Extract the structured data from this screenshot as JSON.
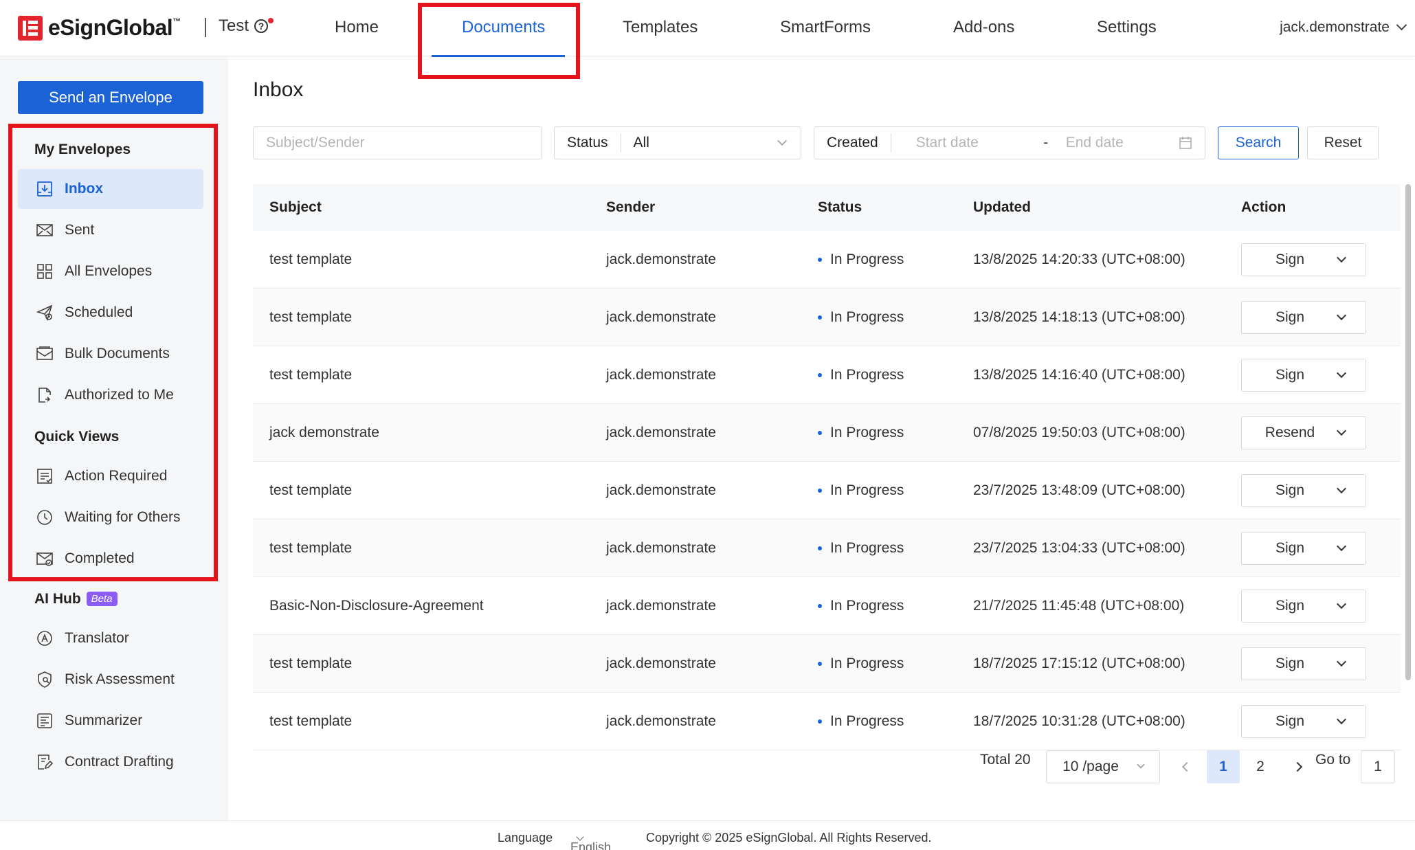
{
  "header": {
    "logo_text": "eSignGlobal",
    "logo_tm": "™",
    "org_name": "Test",
    "help_icon": "?",
    "nav": [
      "Home",
      "Documents",
      "Templates",
      "SmartForms",
      "Add-ons",
      "Settings"
    ],
    "active_nav": "Documents",
    "user": "jack.demonstrate"
  },
  "sidebar": {
    "send_button": "Send an Envelope",
    "my_envelopes_title": "My Envelopes",
    "my_envelopes": [
      {
        "label": "Inbox",
        "icon": "inbox-icon",
        "active": true
      },
      {
        "label": "Sent",
        "icon": "sent-icon"
      },
      {
        "label": "All Envelopes",
        "icon": "grid-icon"
      },
      {
        "label": "Scheduled",
        "icon": "scheduled-icon"
      },
      {
        "label": "Bulk Documents",
        "icon": "bulk-documents-icon"
      },
      {
        "label": "Authorized to Me",
        "icon": "authorized-icon"
      }
    ],
    "quick_views_title": "Quick Views",
    "quick_views": [
      {
        "label": "Action Required",
        "icon": "action-required-icon"
      },
      {
        "label": "Waiting for Others",
        "icon": "clock-icon"
      },
      {
        "label": "Completed",
        "icon": "completed-icon"
      }
    ],
    "ai_hub_title": "AI Hub",
    "ai_hub_badge": "Beta",
    "ai_hub": [
      {
        "label": "Translator",
        "icon": "translator-icon"
      },
      {
        "label": "Risk Assessment",
        "icon": "shield-icon"
      },
      {
        "label": "Summarizer",
        "icon": "summarizer-icon"
      },
      {
        "label": "Contract Drafting",
        "icon": "drafting-icon"
      }
    ]
  },
  "main": {
    "title": "Inbox",
    "filters": {
      "search_placeholder": "Subject/Sender",
      "status_label": "Status",
      "status_value": "All",
      "created_label": "Created",
      "start_placeholder": "Start date",
      "date_separator": "-",
      "end_placeholder": "End date",
      "search_button": "Search",
      "reset_button": "Reset"
    },
    "table": {
      "columns": [
        "Subject",
        "Sender",
        "Status",
        "Updated",
        "Action"
      ],
      "rows": [
        {
          "subject": "test template",
          "sender": "jack.demonstrate",
          "status": "In Progress",
          "updated": "13/8/2025 14:20:33 (UTC+08:00)",
          "action": "Sign"
        },
        {
          "subject": "test template",
          "sender": "jack.demonstrate",
          "status": "In Progress",
          "updated": "13/8/2025 14:18:13 (UTC+08:00)",
          "action": "Sign"
        },
        {
          "subject": "test template",
          "sender": "jack.demonstrate",
          "status": "In Progress",
          "updated": "13/8/2025 14:16:40 (UTC+08:00)",
          "action": "Sign"
        },
        {
          "subject": "jack demonstrate",
          "sender": "jack.demonstrate",
          "status": "In Progress",
          "updated": "07/8/2025 19:50:03 (UTC+08:00)",
          "action": "Resend"
        },
        {
          "subject": "test template",
          "sender": "jack.demonstrate",
          "status": "In Progress",
          "updated": "23/7/2025 13:48:09 (UTC+08:00)",
          "action": "Sign"
        },
        {
          "subject": "test template",
          "sender": "jack.demonstrate",
          "status": "In Progress",
          "updated": "23/7/2025 13:04:33 (UTC+08:00)",
          "action": "Sign"
        },
        {
          "subject": "Basic-Non-Disclosure-Agreement",
          "sender": "jack.demonstrate",
          "status": "In Progress",
          "updated": "21/7/2025 11:45:48 (UTC+08:00)",
          "action": "Sign"
        },
        {
          "subject": "test template",
          "sender": "jack.demonstrate",
          "status": "In Progress",
          "updated": "18/7/2025 17:15:12 (UTC+08:00)",
          "action": "Sign"
        },
        {
          "subject": "test template",
          "sender": "jack.demonstrate",
          "status": "In Progress",
          "updated": "18/7/2025 10:31:28 (UTC+08:00)",
          "action": "Sign"
        }
      ]
    },
    "pagination": {
      "total": "Total 20",
      "page_size": "10 /page",
      "pages": [
        "1",
        "2"
      ],
      "current": "1",
      "goto_label": "Go to",
      "goto_value": "1"
    }
  },
  "footer": {
    "language_label": "Language",
    "language_value": "English",
    "copyright": "Copyright © 2025 eSignGlobal. All Rights Reserved."
  },
  "colors": {
    "brand_red": "#e3262e",
    "accent_blue": "#1a62d6",
    "highlight_red": "#e3141b",
    "beta_purple": "#8b5cf6"
  }
}
